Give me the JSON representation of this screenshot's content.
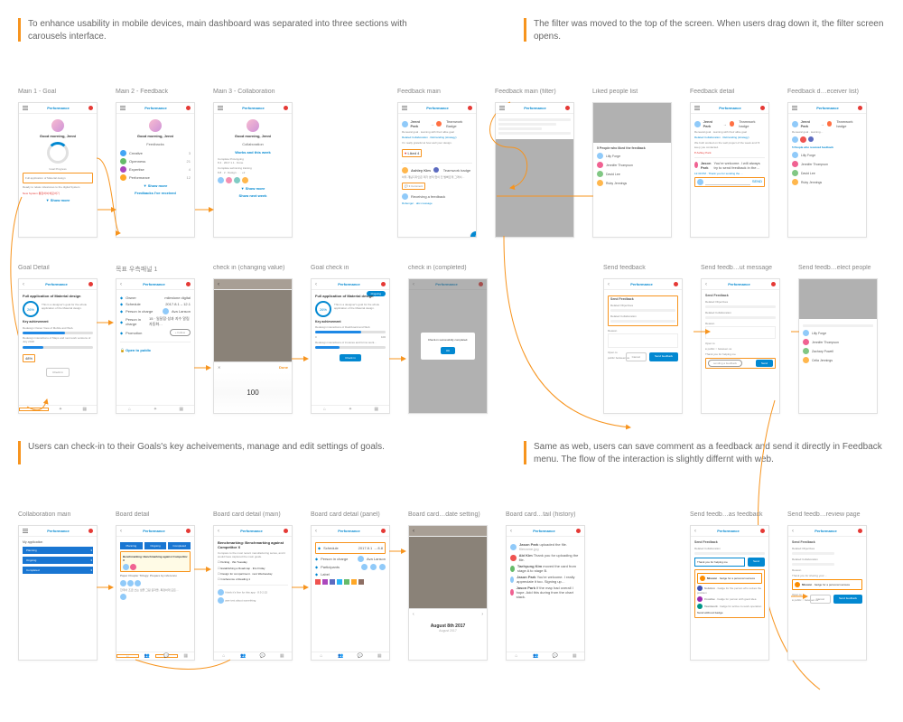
{
  "section1": {
    "desc": "To enhance usability in mobile devices, main dashboard was separated into three sections with carousels interface."
  },
  "section2": {
    "desc": "The filter was moved to the top of the screen. When users drag down it, the filter screen opens."
  },
  "section3": {
    "desc": "Users can check-in to their Goals's key acheivements, manage and edit settings of goals."
  },
  "section4": {
    "desc": "Same as web, users can save comment as a feedback and send it directly in Feedback menu. The flow of the interaction is slightly differnt with web."
  },
  "labels": {
    "main1": "Main 1 - Goal",
    "main2": "Main 2 - Feedback",
    "main3": "Main 3 - Collaboration",
    "goalDetail": "Goal Detail",
    "goalPanel": "목표 우측패널 1",
    "checkinChange": "check in (changing value)",
    "goalCheckin": "Goal check in",
    "checkinComplete": "check in (completed)",
    "fbMain": "Feedback main",
    "fbFilter": "Feedback main (filter)",
    "liked": "Liked people list",
    "fbDetail": "Feedback detail",
    "fbReceiver": "Feedback d…eceiver list)",
    "sendFb": "Send feedback",
    "sendFbMsg": "Send feedb…ut message",
    "sendFbPeople": "Send feedb…elect people",
    "collabMain": "Collaboration main",
    "boardDetail": "Board detail",
    "cardMain": "Board card detail (main)",
    "cardPanel": "Board card detail (panel)",
    "cardDate": "Board card…date setting)",
    "cardHistory": "Board card…tail (history)",
    "sendFbAs": "Send feedb…as feedback",
    "sendFbReview": "Send feedb…review page"
  },
  "app": {
    "brand": "Performance",
    "greeting": "Good morning, Jenni",
    "feedbacks": "Feedbacks",
    "collaboration": "Collaboration",
    "worksThisWeek": "Works and this week",
    "goalProgress": "Goal Progress",
    "showMore": "▼ Show more",
    "feedbackReceived": "Feedbacks I've received",
    "showNext": "Show next week",
    "checkIn": "Check in",
    "done": "Done",
    "hundred": "100",
    "keyAchievement": "Key achievement",
    "openPublic": "Open to public",
    "follow": "+ Follow",
    "benchmarking": "Benchmarking: Benchmarking against Competitor X",
    "dateAug": "August 8th 2017",
    "dateAugSub": "August 2017",
    "sendFeedback": "Send Feedback",
    "relatedObj": "Related Objectives",
    "relatedCollab": "Related Collaboration",
    "reason": "Reason",
    "openTo": "Open to",
    "public": "public",
    "sendBtn": "Send feedback",
    "cancel": "Cancel",
    "thanks": "Thank you for helping me",
    "sendingFeedback": "sending a feedback",
    "completedMsg": "Check-in successfully completed.",
    "detailApp": "Full application of Material design",
    "likedHeader": "5 People who liked the feedback",
    "receiverHeader": "5 People who received feedback",
    "myApp": "My application",
    "planning": "Planning",
    "ongoing": "Ongoing",
    "completed": "Completed",
    "selectBadge": "Select without badge",
    "noBadge": "Send without badge",
    "missionBadge": "Mission",
    "solutionBadge": "Solution",
    "creativeBadge": "Creative",
    "teamworkBadge": "Teamwork"
  },
  "people": {
    "p1": "Lilly Forge",
    "p2": "Jennifer Thompson",
    "p3": "David Lee",
    "p4": "Ruby Jennings",
    "p5": "Jason Park"
  },
  "feedbackList": {
    "i1": "Jenni Park",
    "i2": "Teamwork Badge",
    "i3": "Ashley Kim"
  }
}
